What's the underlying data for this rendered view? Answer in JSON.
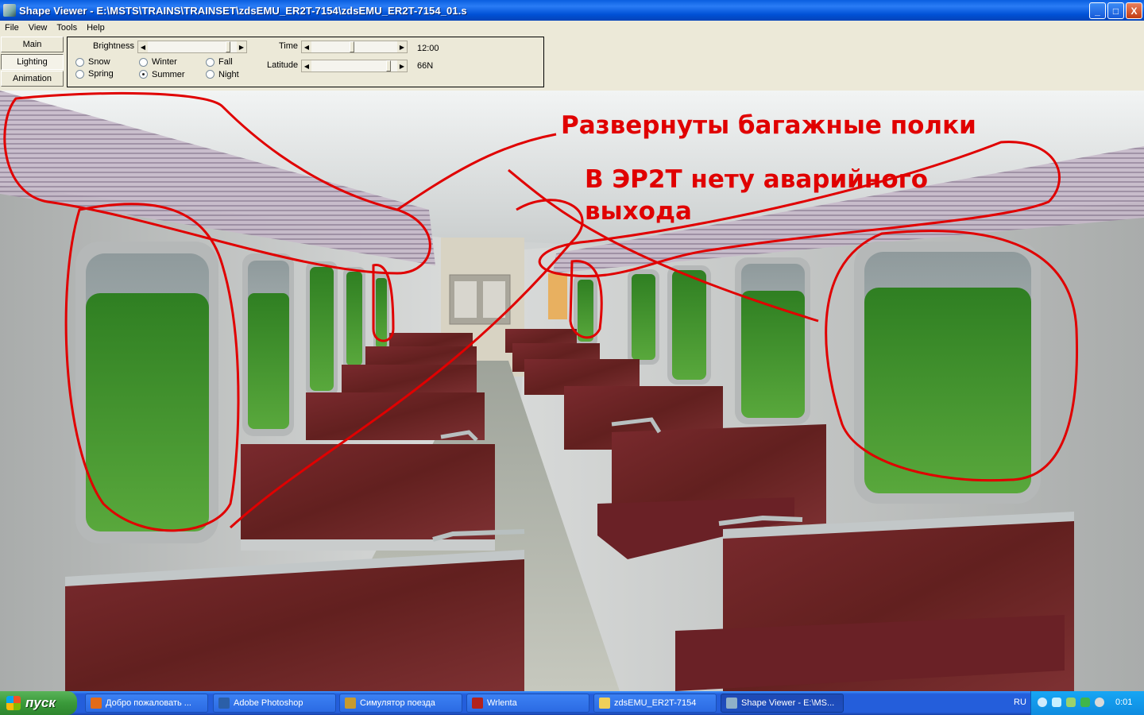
{
  "window": {
    "title": "Shape Viewer - E:\\MSTS\\TRAINS\\TRAINSET\\zdsEMU_ER2T-7154\\zdsEMU_ER2T-7154_01.s",
    "buttons": {
      "minimize": "_",
      "maximize": "□",
      "close": "X"
    }
  },
  "menu": [
    "File",
    "View",
    "Tools",
    "Help"
  ],
  "side_buttons": {
    "main": "Main",
    "lighting": "Lighting",
    "animation": "Animation"
  },
  "lighting": {
    "brightness_label": "Brightness",
    "seasons": {
      "snow": "Snow",
      "winter": "Winter",
      "fall": "Fall",
      "spring": "Spring",
      "summer": "Summer",
      "night": "Night"
    },
    "selected_season": "Summer",
    "time_label": "Time",
    "time_value": "12:00",
    "latitude_label": "Latitude",
    "latitude_value": "66N"
  },
  "annotations": {
    "shelves": "Развернуты багажные полки",
    "exit_line1": "В ЭР2Т нету аварийного",
    "exit_line2": "выхода"
  },
  "colors": {
    "annotation": "#e00000",
    "seat": "#6e2327",
    "grass": "#3f8f2f",
    "floor": "#b9bcb0"
  },
  "taskbar": {
    "start": "пуск",
    "tasks": [
      "Добро пожаловать ...",
      "Adobe Photoshop",
      "Симулятор поезда",
      "Wrlenta",
      "zdsEMU_ER2T-7154",
      "Shape Viewer - E:\\MS..."
    ],
    "language": "RU",
    "clock": "0:01"
  }
}
